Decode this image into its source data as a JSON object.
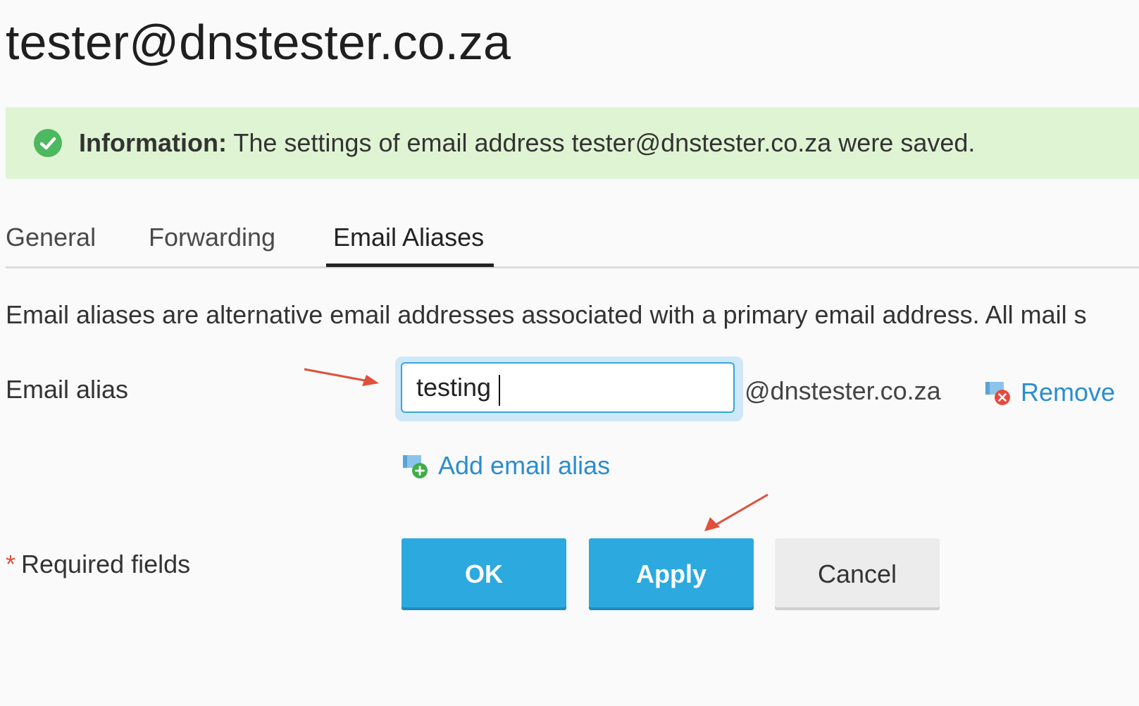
{
  "page": {
    "title": "tester@dnstester.co.za"
  },
  "message": {
    "label": "Information:",
    "text": "The settings of email address tester@dnstester.co.za were saved.",
    "icon": "check-circle-icon",
    "color": "#dff4d3"
  },
  "tabs": [
    {
      "label": "General",
      "active": false
    },
    {
      "label": "Forwarding",
      "active": false
    },
    {
      "label": "Email Aliases",
      "active": true
    }
  ],
  "description": "Email aliases are alternative email addresses associated with a primary email address. All mail s",
  "alias_form": {
    "label": "Email alias",
    "input_value": "testing",
    "domain_suffix": "@dnstester.co.za",
    "remove_label": "Remove",
    "add_label": "Add email alias"
  },
  "footer": {
    "required_star": "*",
    "required_text": "Required fields",
    "ok_label": "OK",
    "apply_label": "Apply",
    "cancel_label": "Cancel"
  },
  "colors": {
    "primary_button": "#2ca9df",
    "link": "#2a8ecf",
    "annotation_arrow": "#e0503b"
  }
}
